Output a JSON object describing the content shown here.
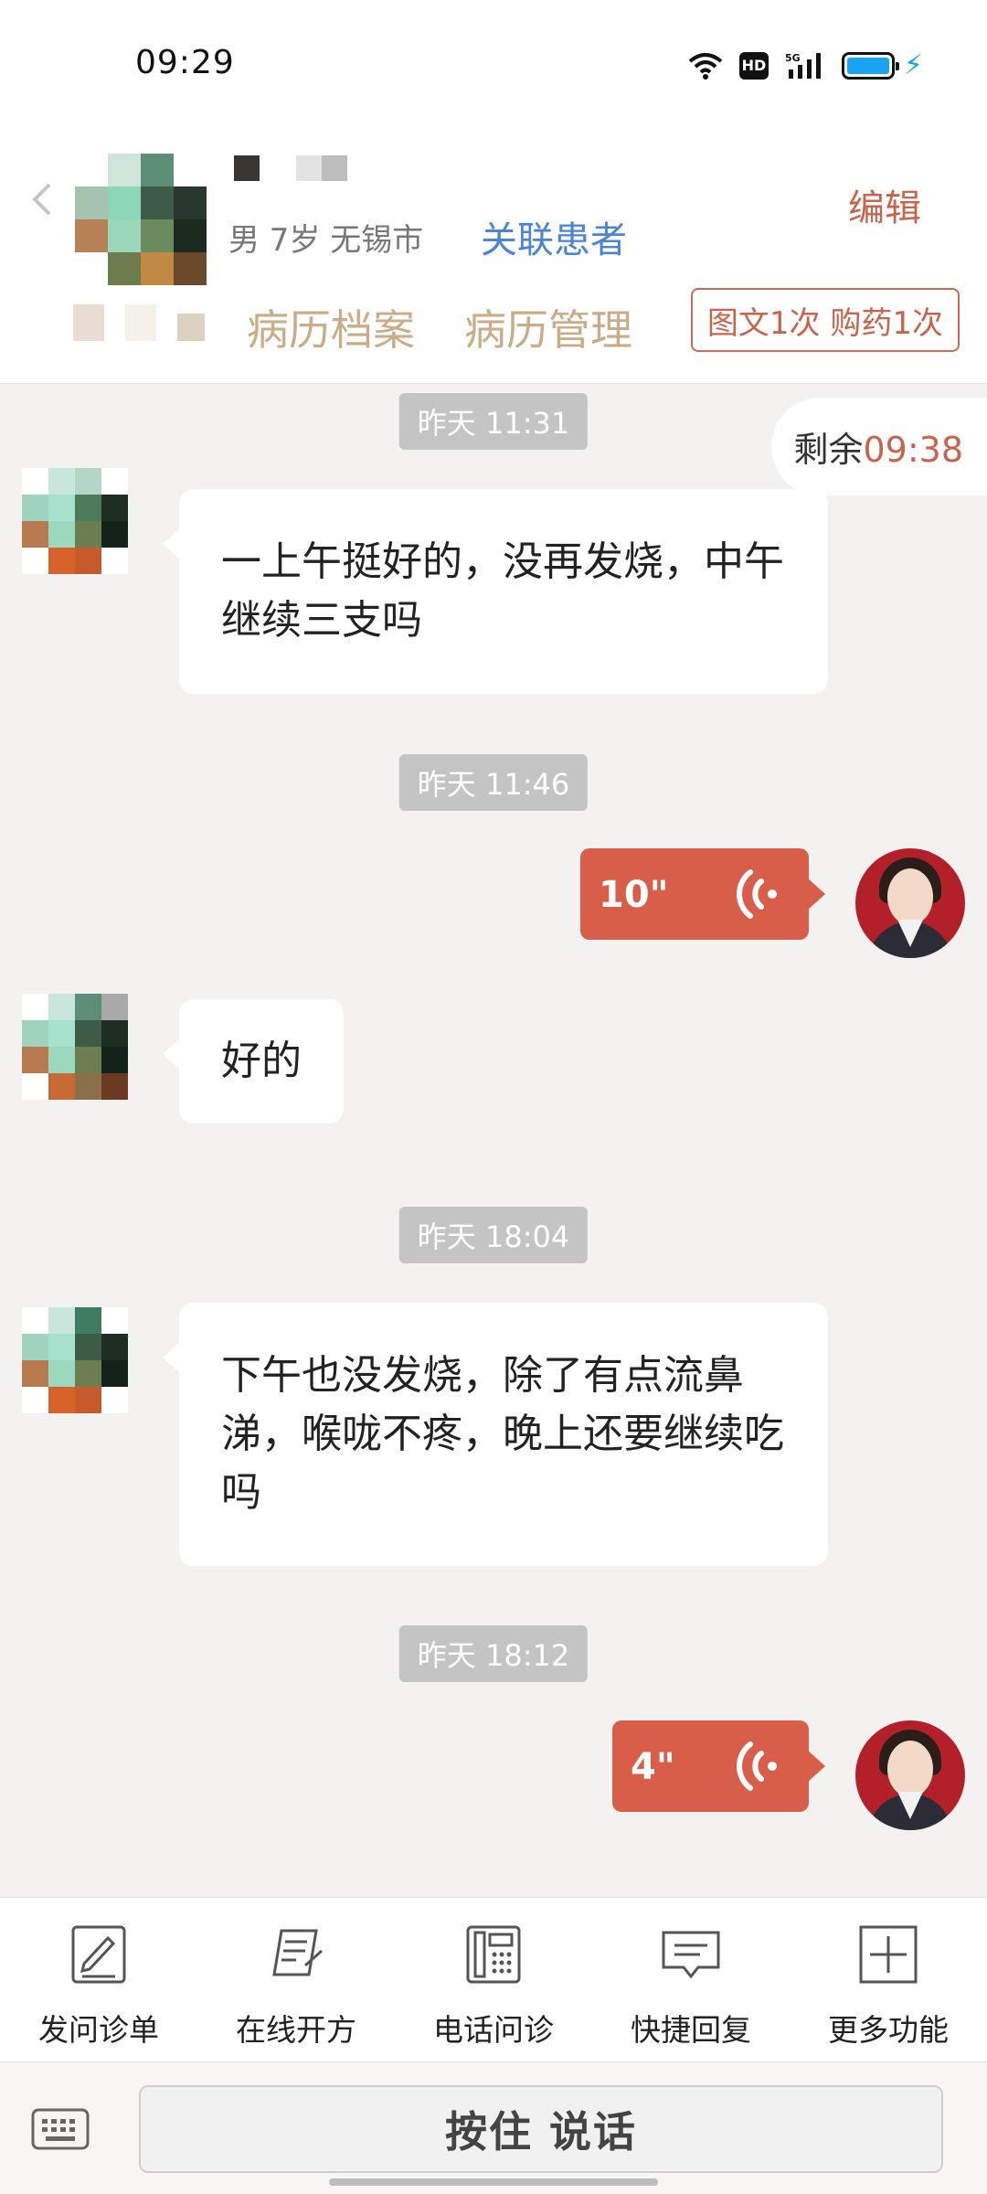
{
  "status_bar": {
    "time": "09:29",
    "icons": [
      "wifi-icon",
      "hd-icon",
      "5g-signal-icon",
      "battery-icon",
      "charging-icon"
    ],
    "hd_label": "HD"
  },
  "header": {
    "patient_meta": "男 7岁  无锡市",
    "link_patient": "关联患者",
    "edit": "编辑",
    "tabs": [
      {
        "label": "病历档案"
      },
      {
        "label": "病历管理"
      }
    ],
    "service_badge": "图文1次 购药1次"
  },
  "chat": {
    "remaining_label": "剩余",
    "remaining_value": "09:38",
    "messages": [
      {
        "timestamp": "昨天 11:31",
        "sender": "patient",
        "text": "一上午挺好的，没再发烧，中午继续三支吗"
      },
      {
        "timestamp": "昨天 11:46",
        "sender": "doctor",
        "voice_duration": "10\""
      },
      {
        "sender": "patient",
        "text": "好的"
      },
      {
        "timestamp": "昨天 18:04",
        "sender": "patient",
        "text": "下午也没发烧，除了有点流鼻涕，喉咙不疼，晚上还要继续吃吗"
      },
      {
        "timestamp": "昨天 18:12",
        "sender": "doctor",
        "voice_duration": "4\""
      }
    ]
  },
  "toolbar": {
    "items": [
      {
        "label": "发问诊单",
        "icon": "form-edit-icon"
      },
      {
        "label": "在线开方",
        "icon": "prescription-icon"
      },
      {
        "label": "电话问诊",
        "icon": "phone-icon"
      },
      {
        "label": "快捷回复",
        "icon": "quick-reply-icon"
      },
      {
        "label": "更多功能",
        "icon": "plus-icon"
      }
    ]
  },
  "input": {
    "talk_button": "按住 说话",
    "keyboard_icon": "keyboard-icon"
  },
  "colors": {
    "accent": "#c8644c",
    "voice_bubble": "#d85e4a",
    "link": "#4c84d4",
    "tab_text": "#c9ad88",
    "chat_bg": "#f3f2f1"
  }
}
